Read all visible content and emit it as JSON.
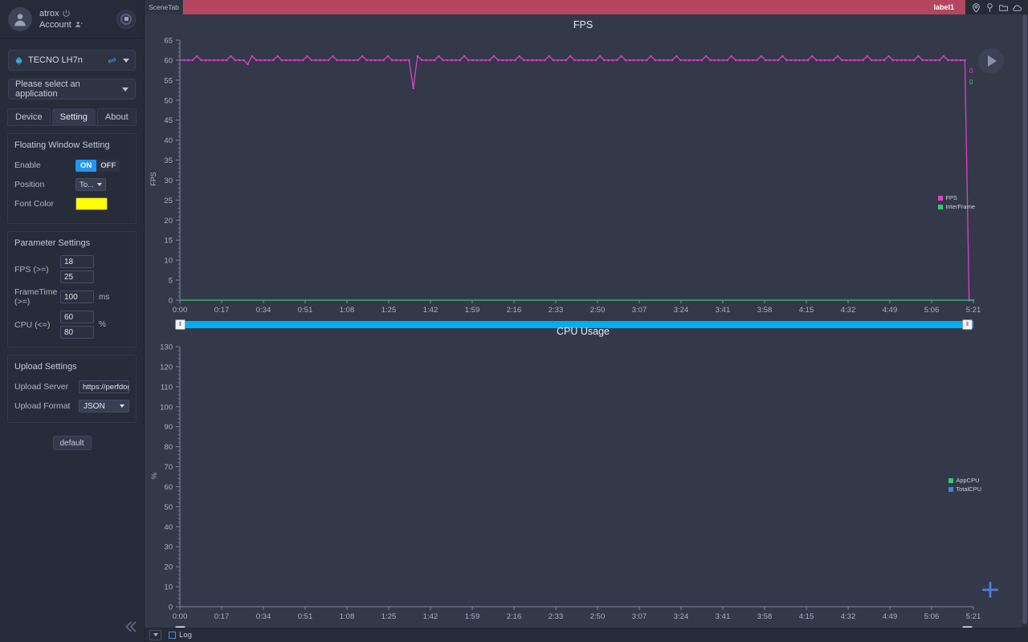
{
  "sidebar": {
    "account": {
      "name": "atrox",
      "sub_label": "Account",
      "power_icon": "power-icon",
      "adduser_icon": "add-user-icon"
    },
    "record_button": "record-stop-button",
    "device": {
      "name": "TECNO LH7n",
      "android_icon": "android-icon",
      "usb_icon": "usb-link-icon"
    },
    "app_select": {
      "value": "Please select an application"
    },
    "tabs": [
      {
        "label": "Device",
        "active": false
      },
      {
        "label": "Setting",
        "active": true
      },
      {
        "label": "About",
        "active": false
      }
    ],
    "floating_window": {
      "title": "Floating Window Setting",
      "enable_label": "Enable",
      "toggle_on": "ON",
      "toggle_off": "OFF",
      "position_label": "Position",
      "position_value": "To...",
      "font_color_label": "Font Color",
      "font_color_value": "#ffff00"
    },
    "parameter_settings": {
      "title": "Parameter Settings",
      "fps_label": "FPS (>=)",
      "fps_value_1": "18",
      "fps_value_2": "25",
      "frametime_label": "FrameTime (>=)",
      "frametime_value": "100",
      "frametime_unit": "ms",
      "cpu_label": "CPU (<=)",
      "cpu_value_1": "60",
      "cpu_value_2": "80",
      "cpu_unit": "%"
    },
    "upload_settings": {
      "title": "Upload Settings",
      "server_label": "Upload Server",
      "server_value": "https://perfdog.",
      "format_label": "Upload Format",
      "format_value": "JSON"
    },
    "default_button": "default",
    "collapse_icon": "chevrons-left-icon"
  },
  "topbar": {
    "scene_tab": "SceneTab",
    "label_tab": "label1",
    "label_tab_color": "#b4475f",
    "icons": [
      "location-pin-icon",
      "marker-pin-icon",
      "folder-icon",
      "cloud-icon"
    ]
  },
  "bottombar": {
    "expand_icon": "caret-down-box-icon",
    "log_label": "Log",
    "log_checked": false
  },
  "fab": {
    "icon": "plus-icon",
    "color": "#4a7fe0"
  },
  "play_button": "play-button",
  "chart_data": [
    {
      "type": "line",
      "title": "FPS",
      "ylabel": "FPS",
      "xlabel": "",
      "ylim": [
        0,
        65
      ],
      "yticks": [
        0,
        5,
        10,
        15,
        20,
        25,
        30,
        35,
        40,
        45,
        50,
        55,
        60,
        65
      ],
      "xticks": [
        "0:00",
        "0:17",
        "0:34",
        "0:51",
        "1:08",
        "1:25",
        "1:42",
        "1:59",
        "2:16",
        "2:33",
        "2:50",
        "3:07",
        "3:24",
        "3:41",
        "3:58",
        "4:15",
        "4:32",
        "4:49",
        "5:06",
        "5:21"
      ],
      "grid": false,
      "legend_position": "right",
      "series": [
        {
          "name": "FPS",
          "color": "#e040c8",
          "end_value": "0",
          "values": [
            60,
            60,
            60,
            60,
            61,
            60,
            60,
            60,
            60,
            60,
            60,
            60,
            61,
            60,
            60,
            60,
            59,
            61,
            60,
            60,
            60,
            60,
            60,
            61,
            60,
            60,
            60,
            60,
            60,
            60,
            61,
            60,
            60,
            60,
            60,
            60,
            61,
            60,
            60,
            60,
            60,
            60,
            60,
            61,
            60,
            60,
            60,
            60,
            60,
            61,
            60,
            60,
            60,
            60,
            60,
            53,
            61,
            60,
            60,
            60,
            60,
            61,
            60,
            60,
            60,
            60,
            60,
            61,
            60,
            60,
            60,
            60,
            60,
            60,
            61,
            60,
            60,
            60,
            60,
            60,
            61,
            60,
            60,
            60,
            60,
            60,
            60,
            61,
            60,
            60,
            60,
            60,
            61,
            60,
            60,
            60,
            60,
            60,
            60,
            61,
            60,
            60,
            60,
            60,
            61,
            60,
            60,
            60,
            60,
            60,
            60,
            61,
            60,
            60,
            60,
            60,
            60,
            61,
            60,
            60,
            60,
            60,
            60,
            60,
            61,
            60,
            60,
            60,
            60,
            60,
            61,
            60,
            60,
            60,
            60,
            60,
            60,
            61,
            60,
            60,
            60,
            60,
            61,
            60,
            60,
            60,
            60,
            60,
            60,
            61,
            60,
            60,
            60,
            60,
            60,
            61,
            60,
            60,
            60,
            60,
            60,
            60,
            61,
            60,
            60,
            60,
            60,
            61,
            60,
            60,
            60,
            60,
            60,
            60,
            61,
            60,
            60,
            60,
            60,
            60,
            61,
            60,
            60,
            60,
            60,
            60,
            0,
            0
          ]
        },
        {
          "name": "InterFrame",
          "color": "#2ecc71",
          "end_value": "0",
          "values": [
            0,
            0,
            0,
            0,
            0,
            0,
            0,
            0,
            0,
            0,
            0,
            0,
            0,
            0,
            0,
            0,
            0,
            0,
            0,
            0,
            0,
            0,
            0,
            0,
            0,
            0,
            0,
            0,
            0,
            0,
            0,
            0,
            0,
            0,
            0,
            0,
            0,
            0,
            0,
            0,
            0,
            0,
            0,
            0,
            0,
            0,
            0,
            0,
            0,
            0,
            0,
            0,
            0,
            0,
            0,
            0,
            0,
            0,
            0,
            0,
            0,
            0,
            0,
            0,
            0,
            0,
            0,
            0,
            0,
            0,
            0,
            0,
            0,
            0,
            0,
            0,
            0,
            0,
            0,
            0,
            0,
            0,
            0,
            0,
            0,
            0,
            0,
            0,
            0,
            0,
            0,
            0,
            0,
            0,
            0,
            0,
            0,
            0,
            0,
            0
          ]
        }
      ]
    },
    {
      "type": "line",
      "title": "CPU Usage",
      "ylabel": "%",
      "xlabel": "",
      "ylim": [
        0,
        130
      ],
      "yticks": [
        0,
        10,
        20,
        30,
        40,
        50,
        60,
        70,
        80,
        90,
        100,
        110,
        120,
        130
      ],
      "xticks": [
        "0:00",
        "0:17",
        "0:34",
        "0:51",
        "1:08",
        "1:25",
        "1:42",
        "1:59",
        "2:16",
        "2:33",
        "2:50",
        "3:07",
        "3:24",
        "3:41",
        "3:58",
        "4:15",
        "4:32",
        "4:49",
        "5:06",
        "5:21"
      ],
      "grid": false,
      "legend_position": "right",
      "series": [
        {
          "name": "AppCPU",
          "color": "#2ecc71",
          "values": []
        },
        {
          "name": "TotalCPU",
          "color": "#4a7fe0",
          "values": []
        }
      ]
    }
  ]
}
